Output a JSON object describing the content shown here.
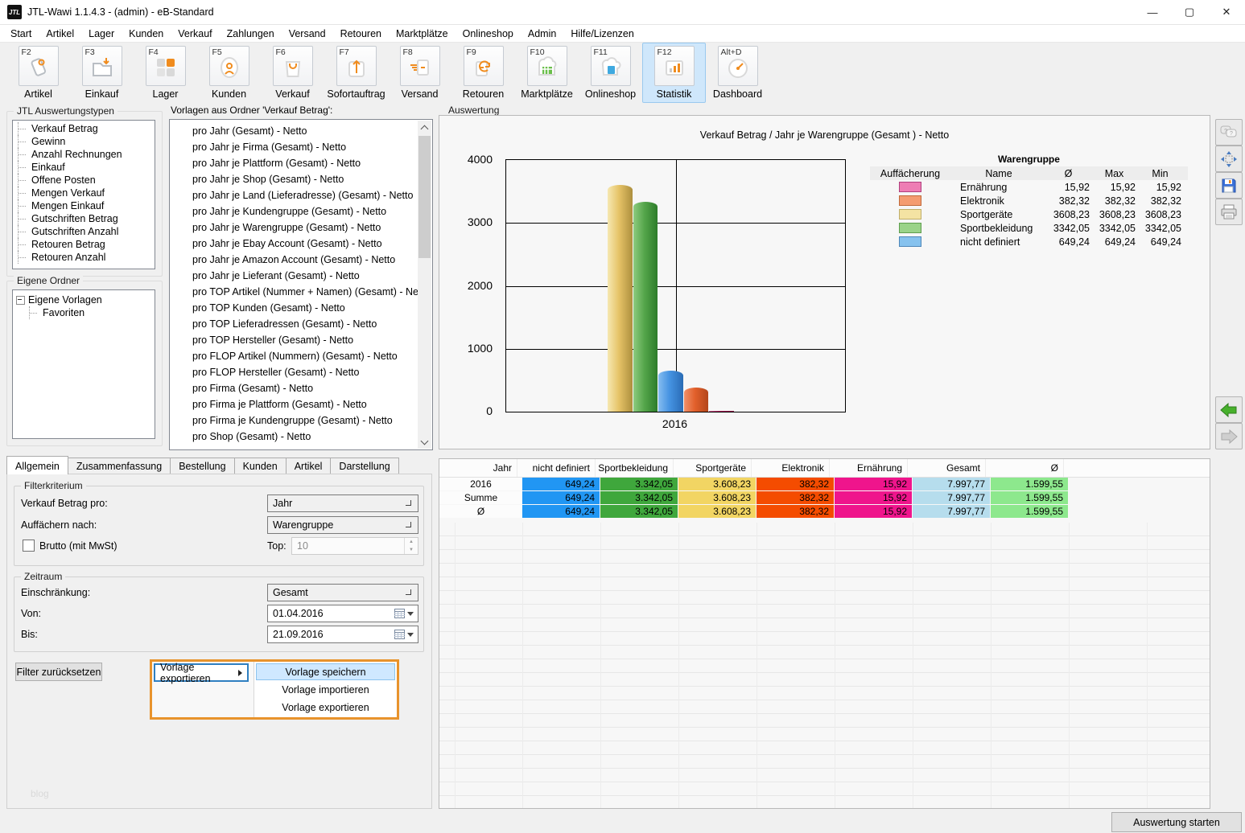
{
  "window": {
    "title": "JTL-Wawi 1.1.4.3 - (admin) - eB-Standard",
    "logo_text": "JTL",
    "controls": [
      {
        "name": "minimize",
        "glyph": "—"
      },
      {
        "name": "maximize",
        "glyph": "▢"
      },
      {
        "name": "close",
        "glyph": "✕"
      }
    ]
  },
  "menu": {
    "items": [
      "Start",
      "Artikel",
      "Lager",
      "Kunden",
      "Verkauf",
      "Zahlungen",
      "Versand",
      "Retouren",
      "Marktplätze",
      "Onlineshop",
      "Admin",
      "Hilfe/Lizenzen"
    ]
  },
  "toolbar": {
    "active": "Statistik",
    "buttons": [
      {
        "key": "F2",
        "label": "Artikel",
        "icon": "tag-icon"
      },
      {
        "key": "F3",
        "label": "Einkauf",
        "icon": "folder-download-icon"
      },
      {
        "key": "F4",
        "label": "Lager",
        "icon": "grid-squares-icon"
      },
      {
        "key": "F5",
        "label": "Kunden",
        "icon": "person-icon"
      },
      {
        "key": "F6",
        "label": "Verkauf",
        "icon": "shopping-bag-icon"
      },
      {
        "key": "F7",
        "label": "Sofortauftrag",
        "icon": "upload-box-icon"
      },
      {
        "key": "F8",
        "label": "Versand",
        "icon": "shipping-note-icon"
      },
      {
        "key": "F9",
        "label": "Retouren",
        "icon": "return-note-icon"
      },
      {
        "key": "F10",
        "label": "Marktplätze",
        "icon": "storefront-icon"
      },
      {
        "key": "F11",
        "label": "Onlineshop",
        "icon": "cloud-shop-icon"
      },
      {
        "key": "F12",
        "label": "Statistik",
        "icon": "bar-chart-icon"
      },
      {
        "key": "Alt+D",
        "label": "Dashboard",
        "icon": "gauge-icon"
      }
    ]
  },
  "left_panel": {
    "types_box": {
      "title": "JTL Auswertungstypen",
      "items": [
        "Verkauf Betrag",
        "Gewinn",
        "Anzahl Rechnungen",
        "Einkauf",
        "Offene Posten",
        "Mengen Verkauf",
        "Mengen Einkauf",
        "Gutschriften Betrag",
        "Gutschriften Anzahl",
        "Retouren Betrag",
        "Retouren Anzahl"
      ]
    },
    "folders_box": {
      "title": "Eigene Ordner",
      "root_label": "Eigene Vorlagen",
      "child_label": "Favoriten"
    }
  },
  "templates_panel": {
    "label": "Vorlagen aus Ordner 'Verkauf Betrag':",
    "items": [
      "pro Jahr (Gesamt) - Netto",
      "pro Jahr je Firma (Gesamt) - Netto",
      "pro Jahr je Plattform (Gesamt) - Netto",
      "pro Jahr je Shop (Gesamt) - Netto",
      "pro Jahr je Land (Lieferadresse) (Gesamt) - Netto",
      "pro Jahr je Kundengruppe (Gesamt) - Netto",
      "pro Jahr je Warengruppe (Gesamt) - Netto",
      "pro Jahr je Ebay Account (Gesamt) - Netto",
      "pro Jahr je Amazon Account (Gesamt) - Netto",
      "pro Jahr je Lieferant (Gesamt) - Netto",
      "pro TOP Artikel (Nummer + Namen) (Gesamt) - Netto",
      "pro TOP Kunden (Gesamt) - Netto",
      "pro TOP Lieferadressen (Gesamt) - Netto",
      "pro TOP Hersteller (Gesamt) - Netto",
      "pro FLOP Artikel (Nummern) (Gesamt) - Netto",
      "pro FLOP Hersteller (Gesamt) - Netto",
      "pro Firma (Gesamt) - Netto",
      "pro Firma je Plattform (Gesamt) - Netto",
      "pro Firma je Kundengruppe (Gesamt) - Netto",
      "pro Shop (Gesamt) - Netto"
    ]
  },
  "analysis_panel": {
    "title": "Auswertung"
  },
  "chart_data": {
    "type": "bar",
    "title": "Verkauf Betrag / Jahr je Warengruppe (Gesamt ) - Netto",
    "categories": [
      "2016"
    ],
    "series": [
      {
        "name": "Sportgeräte",
        "value": 3608.23,
        "color": "#e6c367",
        "color_light": "#f6e8b2",
        "color_dark": "#ad8f3e"
      },
      {
        "name": "Sportbekleidung",
        "value": 3342.05,
        "color": "#55a64b",
        "color_light": "#8ecb80",
        "color_dark": "#2d7c2a"
      },
      {
        "name": "nicht definiert",
        "value": 649.24,
        "color": "#4593e2",
        "color_light": "#85bcf0",
        "color_dark": "#2a6cb5"
      },
      {
        "name": "Elektronik",
        "value": 382.32,
        "color": "#e2602b",
        "color_light": "#f0906a",
        "color_dark": "#b3471c"
      },
      {
        "name": "Ernährung",
        "value": 15.92,
        "color": "#b01e5a",
        "color_light": "#d45f93",
        "color_dark": "#8a1545"
      }
    ],
    "ylim": [
      0,
      4000
    ],
    "yticks": [
      0,
      1000,
      2000,
      3000,
      4000
    ],
    "grid": true,
    "legend_position": "right",
    "legend_table": {
      "title": "Warengruppe",
      "headers": [
        "Auffächerung",
        "Name",
        "Ø",
        "Max",
        "Min"
      ],
      "rows": [
        {
          "swatch": "#ee7db4",
          "border": "#b0407e",
          "name": "Ernährung",
          "avg": "15,92",
          "max": "15,92",
          "min": "15,92"
        },
        {
          "swatch": "#f49c70",
          "border": "#c06a3c",
          "name": "Elektronik",
          "avg": "382,32",
          "max": "382,32",
          "min": "382,32"
        },
        {
          "swatch": "#f4e3a3",
          "border": "#bfae6a",
          "name": "Sportgeräte",
          "avg": "3608,23",
          "max": "3608,23",
          "min": "3608,23"
        },
        {
          "swatch": "#9ad389",
          "border": "#5f9e4e",
          "name": "Sportbekleidung",
          "avg": "3342,05",
          "max": "3342,05",
          "min": "3342,05"
        },
        {
          "swatch": "#86c2ee",
          "border": "#4f87b8",
          "name": "nicht definiert",
          "avg": "649,24",
          "max": "649,24",
          "min": "649,24"
        }
      ]
    }
  },
  "result_table": {
    "headers": [
      "Jahr",
      "nicht definiert",
      "Sportbekleidung",
      "Sportgeräte",
      "Elektronik",
      "Ernährung",
      "Gesamt",
      "Ø"
    ],
    "rows": [
      {
        "label": "2016",
        "cells": [
          {
            "v": "649,24",
            "bg": "#2196f3"
          },
          {
            "v": "3.342,05",
            "bg": "#3fa73c"
          },
          {
            "v": "3.608,23",
            "bg": "#f2d563"
          },
          {
            "v": "382,32",
            "bg": "#f44c00"
          },
          {
            "v": "15,92",
            "bg": "#ef158c"
          },
          {
            "v": "7.997,77",
            "bg": "#b6dded"
          },
          {
            "v": "1.599,55",
            "bg": "#8de88d"
          }
        ]
      },
      {
        "label": "Summe",
        "cells": [
          {
            "v": "649,24",
            "bg": "#2196f3"
          },
          {
            "v": "3.342,05",
            "bg": "#3fa73c"
          },
          {
            "v": "3.608,23",
            "bg": "#f2d563"
          },
          {
            "v": "382,32",
            "bg": "#f44c00"
          },
          {
            "v": "15,92",
            "bg": "#ef158c"
          },
          {
            "v": "7.997,77",
            "bg": "#b6dded"
          },
          {
            "v": "1.599,55",
            "bg": "#8de88d"
          }
        ]
      },
      {
        "label": "Ø",
        "cells": [
          {
            "v": "649,24",
            "bg": "#2196f3"
          },
          {
            "v": "3.342,05",
            "bg": "#3fa73c"
          },
          {
            "v": "3.608,23",
            "bg": "#f2d563"
          },
          {
            "v": "382,32",
            "bg": "#f44c00"
          },
          {
            "v": "15,92",
            "bg": "#ef158c"
          },
          {
            "v": "7.997,77",
            "bg": "#b6dded"
          },
          {
            "v": "1.599,55",
            "bg": "#8de88d"
          }
        ]
      }
    ]
  },
  "filter_panel": {
    "tabs": [
      "Allgemein",
      "Zusammenfassung",
      "Bestellung",
      "Kunden",
      "Artikel",
      "Darstellung"
    ],
    "active_tab": "Allgemein",
    "filterkriterium": {
      "title": "Filterkriterium",
      "row1_label": "Verkauf Betrag pro:",
      "row1_value": "Jahr",
      "row2_label": "Auffächern nach:",
      "row2_value": "Warengruppe",
      "checkbox_label": "Brutto (mit MwSt)",
      "checkbox_checked": false,
      "top_label": "Top:",
      "top_value": "10"
    },
    "zeitraum": {
      "title": "Zeitraum",
      "restriction_label": "Einschränkung:",
      "restriction_value": "Gesamt",
      "von_label": "Von:",
      "von_value": "01.04.2016",
      "bis_label": "Bis:",
      "bis_value": "21.09.2016"
    },
    "reset_button": "Filter zurücksetzen"
  },
  "context_menu": {
    "trigger_label": "Vorlage exportieren",
    "items": [
      {
        "label": "Vorlage speichern",
        "highlighted": true
      },
      {
        "label": "Vorlage importieren",
        "highlighted": false
      },
      {
        "label": "Vorlage exportieren",
        "highlighted": false
      }
    ]
  },
  "side_toolbar_icons": [
    "help-icon",
    "pan-icon",
    "save-icon",
    "print-icon",
    "back-icon",
    "forward-icon"
  ],
  "footer": {
    "start_button": "Auswertung starten",
    "watermark": "blog"
  }
}
